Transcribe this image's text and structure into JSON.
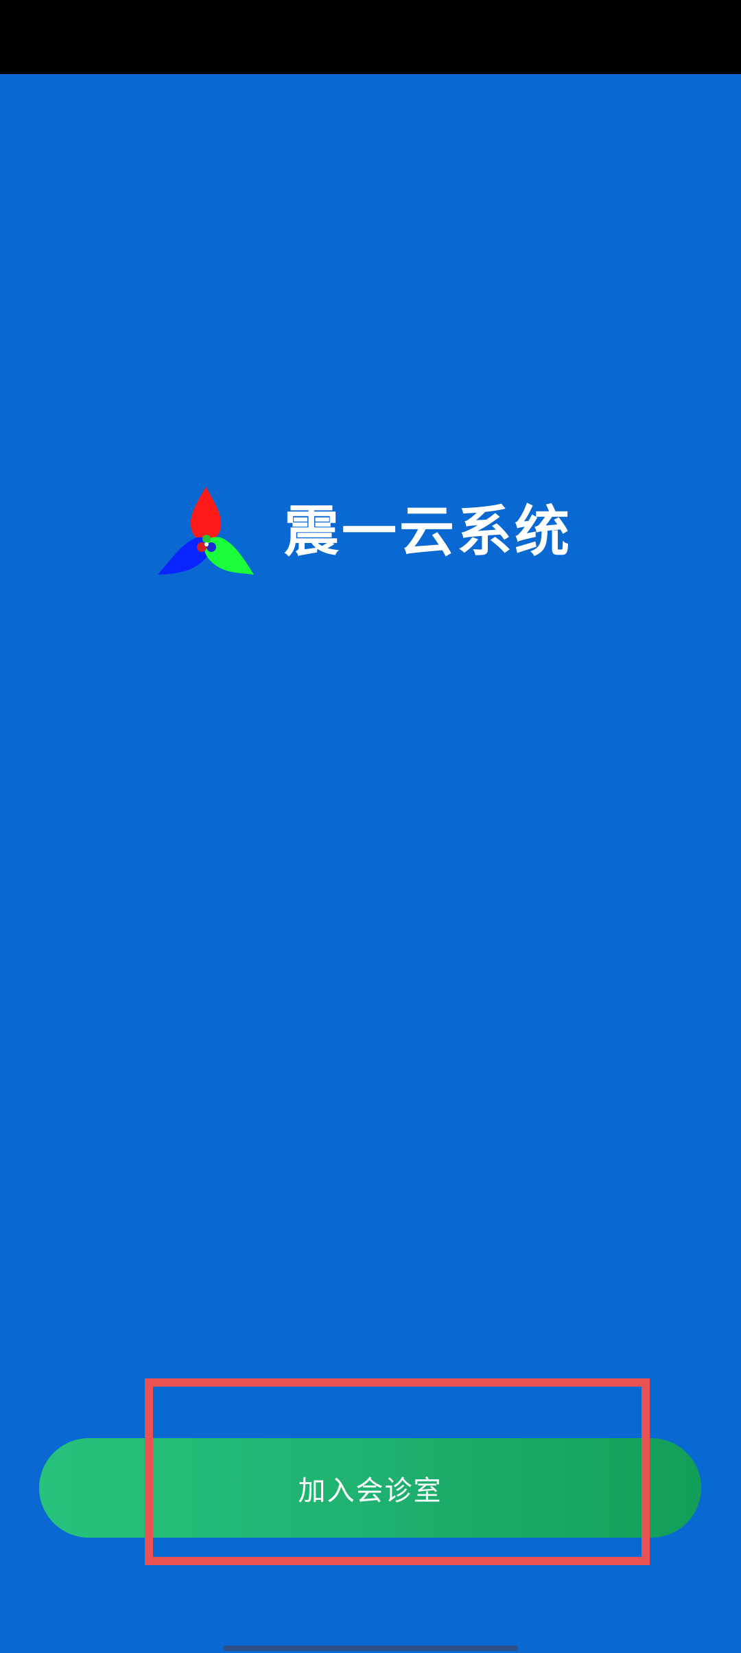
{
  "app": {
    "title": "震一云系统",
    "logo_icon": "tri-petal-logo-icon"
  },
  "actions": {
    "join_label": "加入会诊室"
  },
  "colors": {
    "background": "#0a68d2",
    "button_start": "#26c37c",
    "button_end": "#129e58",
    "highlight": "#e95353",
    "logo_red": "#ff1a1a",
    "logo_blue": "#0a24ff",
    "logo_green": "#1aff3a"
  }
}
